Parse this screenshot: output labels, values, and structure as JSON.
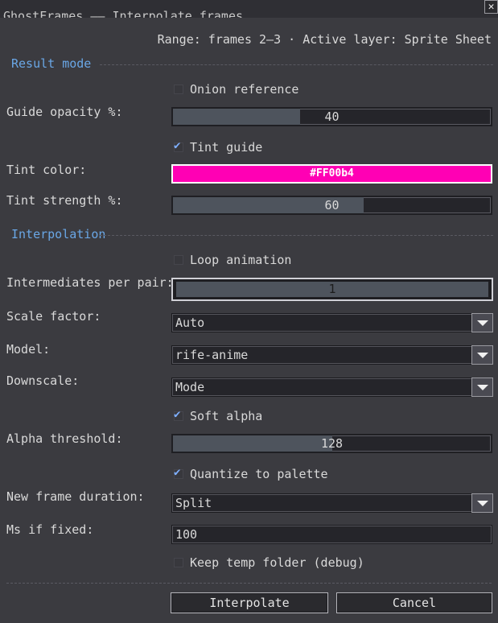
{
  "window": {
    "title": "GhostFrames —— Interpolate frames",
    "close_label": "✕"
  },
  "range_info": "Range: frames 2—3 · Active layer: Sprite Sheet",
  "result_mode": {
    "section_title": "Result mode",
    "onion_reference": {
      "label": "Onion reference",
      "checked": false
    },
    "guide_opacity": {
      "label": "Guide opacity %:",
      "value": "40",
      "percent": 40
    },
    "tint_guide": {
      "label": "Tint guide",
      "checked": true
    },
    "tint_color": {
      "label": "Tint color:",
      "value": "#FF00b4",
      "color": "#ff00b4"
    },
    "tint_strength": {
      "label": "Tint strength %:",
      "value": "60",
      "percent": 60
    }
  },
  "interpolation": {
    "section_title": "Interpolation",
    "loop_animation": {
      "label": "Loop animation",
      "checked": false
    },
    "intermediates": {
      "label": "Intermediates per pair:",
      "value": "1"
    },
    "scale_factor": {
      "label": "Scale factor:",
      "value": "Auto"
    },
    "model": {
      "label": "Model:",
      "value": "rife-anime"
    },
    "downscale": {
      "label": "Downscale:",
      "value": "Mode"
    },
    "soft_alpha": {
      "label": "Soft alpha",
      "checked": true
    },
    "alpha_threshold": {
      "label": "Alpha threshold:",
      "value": "128",
      "fraction": 0.5
    },
    "quantize": {
      "label": "Quantize to palette",
      "checked": true
    },
    "frame_duration": {
      "label": "New frame duration:",
      "value": "Split"
    },
    "ms_if_fixed": {
      "label": "Ms if fixed:",
      "value": "100"
    },
    "keep_temp": {
      "label": "Keep temp folder (debug)",
      "checked": false
    }
  },
  "buttons": {
    "interpolate": "Interpolate",
    "cancel": "Cancel"
  },
  "colors": {
    "accent": "#6aa7e6",
    "background": "#3b3b40",
    "check": "#7fb0ff"
  }
}
